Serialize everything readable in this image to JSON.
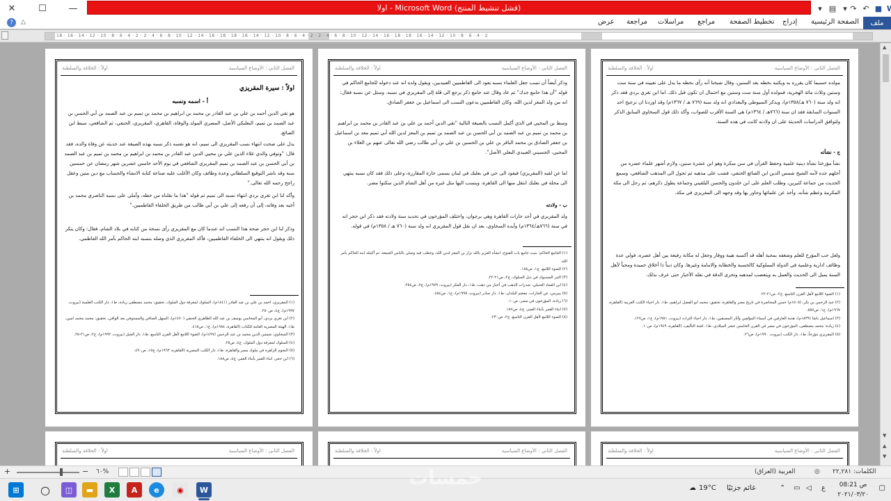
{
  "window": {
    "title": "اولا - Microsoft Word  (فشل تنشيط المنتج)",
    "close_glyph": "✕",
    "maximize_glyph": "☐",
    "minimize_glyph": "—",
    "help_glyph": "?"
  },
  "ribbon": {
    "file_tab": "ملف",
    "tabs": [
      "الصفحة الرئيسية",
      "إدراج",
      "تخطيط الصفحة",
      "مراجع",
      "مراسلات",
      "مراجعة",
      "عرض"
    ]
  },
  "ruler": {
    "ticks": "18 · 16 · 14 · 12 · 10 · 8 · 6 · 4 · 2 · 2 · 4 · 6 · 8 · 10 · 12 · 14 · 16 · 18 · 18 · 16 · 14 · 12 · 10 · 8 · 6 · 4 · 2 · 2 · 4 · 6 · 8 · 10 · 12 · 14 · 16 · 18 · 18 · 16 · 14 · 12 · 10 · 8 · 6 · 4 · 2"
  },
  "header": {
    "left": "اولاً : الخلافة والسلطنة",
    "right": "الفصل الثاني : الأوضاع السياسية"
  },
  "page1": {
    "body_top": "مولده حسبما كان يقرره به ويكتبه بخطه بعد السنين، وقال شيخنا أنه رأى بخطه ما يدل على تعيينه في سنة ست وستين وثلاث مائة الهجرية، فمولده أول سنة ست وستين مع احتمال ان تكون قبل ذلك. اما ابن تغري بردي فقد ذكر انه ولد سنة (٧٦٠ هـ/١٣٥٨م)، ويذكر السيوطي والبغدادي انه ولد سنة (٧٦٩ هـ / ١٣٦٧م) وقد اوردنا ان ترجيح احد السنوات السابقة فقد ان سنة (٧٦٦هـ / ١٣٦٤م) هي السنة الأقرب للصواب، وأكد ذلك قول السخاوي السابق الذكر ولتوافق الدراسات الحديثة على ان ولادته كانت في هذه السنة.",
    "subheading": "ج - نشأته",
    "body_mid": "نشأ مؤرخنا نشأة دينية علمية وحفظ القرآن في سن مبكرة وهو ابن عشرة سنين، ولازم أشهر علماء عصره من أجلهم جده لأمه الشيخ شمس الدين ابن الصائغ الحنفي، فشب على مذهبه ثم تحول الى المذهب الشافعي، وسمع الحديث من جماعة كثيرين، وطلب العلم على ابن خلدون والحسن البلقيني وجماعة يطول ذكرهم، ثم رحل الى مكة المكرمة وعظم شأنه، وأخذ عن علمائها وجاور بها وقد وجهه الى المقريزي في مكة.",
    "body_low": "ولعل حب المؤرخ للعلم وشغفه بمحبة أهله قد أكسبه هيبة ووقار وجعل له مكانة رفيعة بين أهل عصره، فولي عدة وظائف ادارية وعلمية في الدولة المملوكية كالحسبة والخطابة والامامة وغيرها. وكان ديناً ذا أخلاق حميدة ومحباً لأهل السنة يميل الى الحديث والعمل به ويتعصب لمذهبه وتحرى الدقة في نقله الأخبار حتى عرف بذلك.",
    "footnotes": [
      "(١) الضوء اللامع لأهل القرن التاسع، ج٢، ص٢١-٢٢.",
      "(٢) عبد الرحمن بن بكر، (١٥٠٥م) حسن المحاضرة في تاريخ مصر والقاهرة، تحقيق: محمد ابو الفضل ابراهيم، ط١، دار احياء الكتب العربية (القاهرة، ١٩٦٧م)، ج١، ص٥٥٧.",
      "(٣) اسماعيل باشا (١٨٣٩م)، هدية العارفين في أسماء المؤلفين وآثار المصنفين، ط١، دار احياء التراث (بيروت، ١٩٥١م)، ج١، ص١٢٧.",
      "(٤) زيادة: محمد مصطفى، المؤرخون في مصر في القرن الخامس عشر الميلادي، ط١، لجنة التأليف، (القاهرة، ١٩٤٩م)، ص١٠.",
      "(٥) المقريزي مؤرخاً، ط١، دار الكتب (بيروت، ١٩٩٠م)، ص٢٦."
    ]
  },
  "page2": {
    "body_top": "وذكر أيضاً أن نسب جعل العلماء نسبه يعود الى الفاطميين العبيديين، ويقول ولده انه عند دخوله للجامع الحاكم في قوله \"أن هذا جامع جدك\" ثم عاد وقال عند جامع ذكر يرجع الى قلة إلى المقريزي في نسبه. وسئل عن نسبه فقال: انه من ولد المعز لدين الله، وكان الفاطميين يدعون النسب الى اسماعيل بن جعفر الصادق.",
    "body_mid": "وسط بن المحيي في الذي أكمل النسب بالصيغة التالية \"تقي الدين أحمد بن علي بن عبد القادر بن محمد بن ابراهيم بن محمد بن تميم بن عبد الصمد بن أبي الحسن بن عبد الصمد بن تميم بن المعز لدين الله أبي تميم معد بن اسماعيل بن جعفر الصادق بن محمد الباقر بن علي بن الحسين بن علي بن أبي طالب رضي الله تعالى عنهم بن العلاء بن المحيي، الحسيني العبيدي البعلي الأصل\".",
    "body_low": "اما عن لقبه (المقريزي) فيعود الى حي في بعلبك في لبنان يسمى حارة المقارزة، وعلى ذلك فقد كان نسبه ينتهي الى محلة في بعلبك انتقل منها الى القاهرة، وينسب اليها مثل غيره من أهل الشام الذين سكنوا مصر.",
    "subheading": "ب - ولادته",
    "body_last": "ولد المقريزي في أحد حارات القاهرة وهي برجوان، واختلف المؤرخون في تحديد سنة ولادته فقد ذكر ابن حجر انه في سنة (٧٦٦هـ/١٣٦٤م) وأيده السخاوي، بعد ان نقل قول المقريزي انه ولد سنة (٧٦٠ هـ / ١٣٥٨م) في قوله.",
    "footnotes": [
      "(١) الجامع الحاكم: بنيت جامع باب الفتوح، انشأه العزيز بالله نزار بن المعز لدين الله، وخطب فيه وصلى بالناس الجمعة، ثم أكمله ابنه الحاكم بأمر الله.",
      "(٢) الضوء اللامع، ج١، ص١٨٨.",
      "(٣) التبر المسبوك في ذيل السلوك، ج٢، ص٢١-٢٢.",
      "(٤) ابن العماد الحنبلي، شذرات الذهب في أخبار من ذهب، ط١، دار الفكر (بيروت، ١٩٧٩م)، ج٧، ص٢٥٤.",
      "(٥) بيبرس، عن الحارات، معجم البلدان، ط١، دار صادر (بيروت، ١٩٩٥م)، ج١، ص٤٥٤.",
      "(٦) زيادة، المؤرخون في مصر، ص١٠.",
      "(٧) انباء الغمر بأبناء العمر، ج٤، ص١٨٧.",
      "(٨) الضوء اللامع لأهل القرن التاسع، ج٢، ص٢٣٠."
    ]
  },
  "page3": {
    "title": "اولاً : سيرة المقريزي",
    "subtitle": "أ - اسمه ونسبه",
    "body_top": "هو تقي الدين أحمد بن علي بن عبد القادر بن محمد بن ابراهيم بن محمد بن تميم بن عبد الصمد بن أبي الحسن بن عبد الصمد بن تميم، البعلبكي الأصل، المصري المولد والوفاة، القاهري، المقريزي، الحنفي، ثم الشافعي، سبط ابن الصائغ.",
    "body_mid": "يدل على صحت انتهاء نسب المقريزي الى تميم، انه هو نفسه ذكر نسبه بهذه الصيغة عند حديثه عن وفاة والده، فقد قال: \"وتوفي والدي علاء الدين علي بن محيي الدين عبد القادر بن محمد بن ابراهيم بن محمد بن تميم بن عبد الصمد بن أبي الحسن بن عبد الصمد بن تميم المقريزي الشافعي في يوم الأحد خامس عشرين شهر رمضان عن خمسين سنة وقد باشر التوقيع السلطاني وعدة وظائف وكان الأغلب عليه صناعة كتابة الانشاء والحساب مع دين متين وعقل راجح رحمه الله تعالى.\"",
    "body_low": "وأكد لنا ابن تغري بردي انتهاء نسبه الى تميم ثم قوله \"هذا ما نقلناه من خطه، وأملى على نسبه الناصري محمد بن أخيه بعد وفاته، إلى أن رفعه إلى علي بن أبي طالب من طريق الخلفاء الفاطميين.\"",
    "body_last": "وذكر لنا ابن حجر صحة هذا النسب انه عندما كان مع المقريزي رأى نسخة من كتابه في بلاد الشام، فقال: وكان ينكر ذلك ويقول انه ينتهي الى الخلفاء الفاطميين، فأكد المقريزي الذي وصله بنسبه ابنه الحاكم بأمر الله الفاطمي.",
    "footnotes": [
      "(١) المقريزي، احمد بن علي بن عبد القادر (١٤٤١م)، السلوك لمعرفة دول الملوك، تحقيق: محمد مصطفى زيادة، ط١، دار الكتب العلمية (بيروت، ١٩٩٧م)، ج٤، ص٢٥٠.",
      "(٢) ابن تغري بردي، أبو المحاسن يوسف بن عبد الله الظاهري الحنفي (١٤٧٠م)، المنهل الصافي والمستوفي بعد الوافي، تحقيق: محمد محمد امين، ط١، الهيئة المصرية العامة للكتاب (القاهرة، ١٩٨٤م)، ج١، ص٤١٥.",
      "(٣) السخاوي، شمس الدين محمد بن عبد الرحمن (١٤٩٧م)، الضوء اللامع لأهل القرن التاسع، ط١، دار الجيل (بيروت، ١٩٩٢م)، ج٢، ص٢١-٢٥.",
      "(٤) السلوك لمعرفة دول الملوك، ج٤، ص٢٥.",
      "(٥) النجوم الزاهرة في ملوك مصر والقاهرة، ط١، دار الكتب المصرية (القاهرة، ١٩٦٣م)، ج١٥، ص٤٩٠.",
      "(٦) ابن حجر، انباء الغمر بأبناء العمر، ج٤، ص١٨٨."
    ]
  },
  "statusbar": {
    "words": "الكلمات: ٢٢,٢٨١",
    "language": "العربية (العراق)",
    "zoom": "٦٠%",
    "zoom_minus": "−",
    "zoom_plus": "+"
  },
  "taskbar": {
    "weather_temp": "19°C",
    "weather_text": "غائم جزئيًا",
    "lang": "ع",
    "time": "08:21 ص",
    "date": "٢٠٢١/٠٣/٢٠"
  },
  "watermark": "خمسات",
  "colors": {
    "accent": "#2b579a",
    "title_alert": "#e81212"
  }
}
